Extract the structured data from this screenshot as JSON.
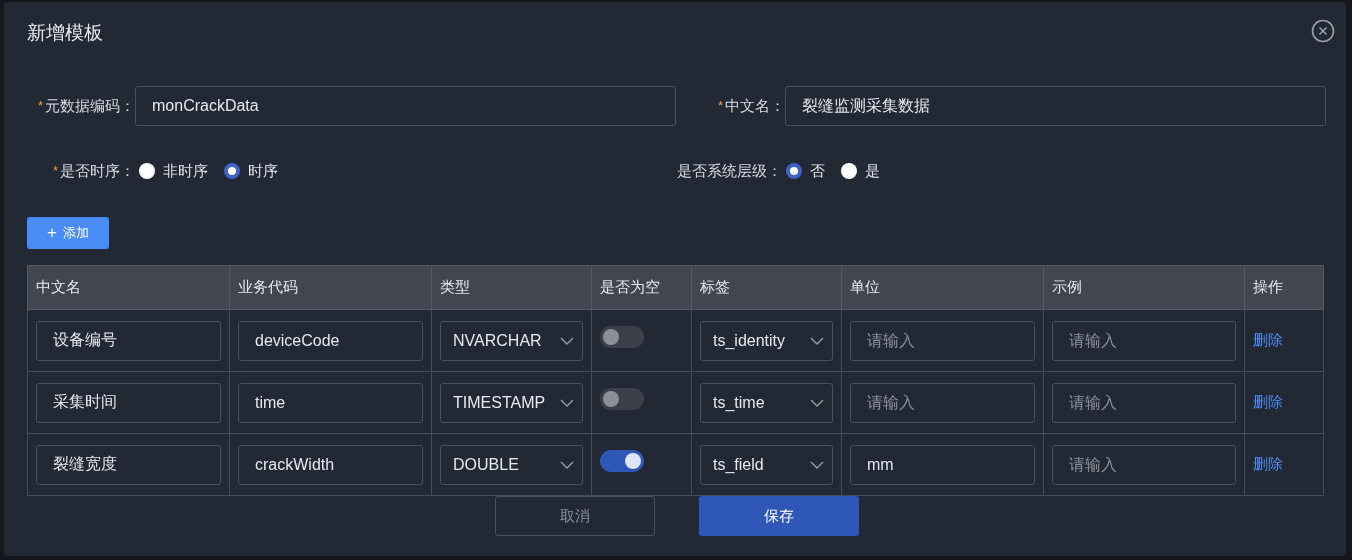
{
  "dialog": {
    "title": "新增模板"
  },
  "fields": [
    {
      "mark": "*",
      "label": "元数据编码：",
      "value": "monCrackData"
    },
    {
      "mark": "*",
      "label": "中文名：",
      "value": "裂缝监测采集数据"
    }
  ],
  "radio_groups": [
    {
      "mark": "*",
      "label": "是否时序：",
      "options": [
        {
          "label": "非时序",
          "selected": false
        },
        {
          "label": "时序",
          "selected": true
        }
      ]
    },
    {
      "label": "是否系统层级：",
      "options": [
        {
          "label": "否",
          "selected": true
        },
        {
          "label": "是",
          "selected": false
        }
      ]
    }
  ],
  "add_button": {
    "icon": "+",
    "label": "添加"
  },
  "table": {
    "columns": [
      "中文名",
      "业务代码",
      "类型",
      "是否为空",
      "标签",
      "单位",
      "示例",
      "操作"
    ],
    "rows": [
      {
        "name": "设备编号",
        "code": "deviceCode",
        "type": "NVARCHAR",
        "nullable": false,
        "tag": "ts_identity",
        "unit": {
          "placeholder": "请输入"
        },
        "example": {
          "placeholder": "请输入"
        },
        "action": "删除"
      },
      {
        "name": "采集时间",
        "code": "time",
        "type": "TIMESTAMP",
        "nullable": false,
        "tag": "ts_time",
        "unit": {
          "placeholder": "请输入"
        },
        "example": {
          "placeholder": "请输入"
        },
        "action": "删除"
      },
      {
        "name": "裂缝宽度",
        "code": "crackWidth",
        "type": "DOUBLE",
        "nullable": true,
        "tag": "ts_field",
        "unit": {
          "value": "mm"
        },
        "example": {
          "placeholder": "请输入"
        },
        "action": "删除"
      }
    ]
  },
  "buttons": [
    {
      "kind": "cancel",
      "label": "取消"
    },
    {
      "kind": "primary",
      "label": "保存"
    }
  ]
}
